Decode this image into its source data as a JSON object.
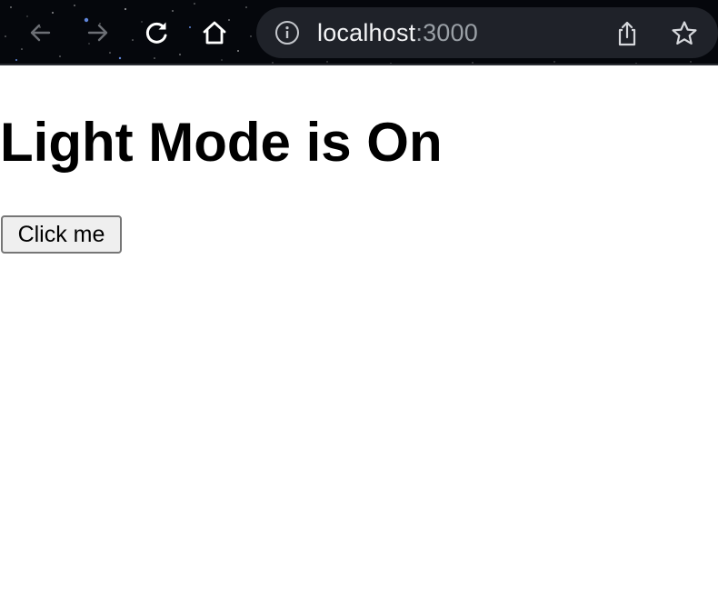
{
  "browser": {
    "address_bar": {
      "host": "localhost",
      "port": ":3000"
    },
    "icons": {
      "back": "arrow-left-icon",
      "forward": "arrow-right-icon",
      "reload": "reload-icon",
      "home": "home-icon",
      "site_info": "info-icon",
      "share": "share-icon",
      "bookmark": "star-icon"
    },
    "colors": {
      "toolbar_background": "#05070c",
      "urlbar_background": "#1f2229",
      "url_host": "#f2f3f5",
      "url_port": "#9aa0a6"
    }
  },
  "page": {
    "heading": "Light Mode is On",
    "button_label": "Click me",
    "colors": {
      "background": "#ffffff",
      "text": "#000000",
      "button_background": "#efefef",
      "button_border": "#767676"
    }
  }
}
